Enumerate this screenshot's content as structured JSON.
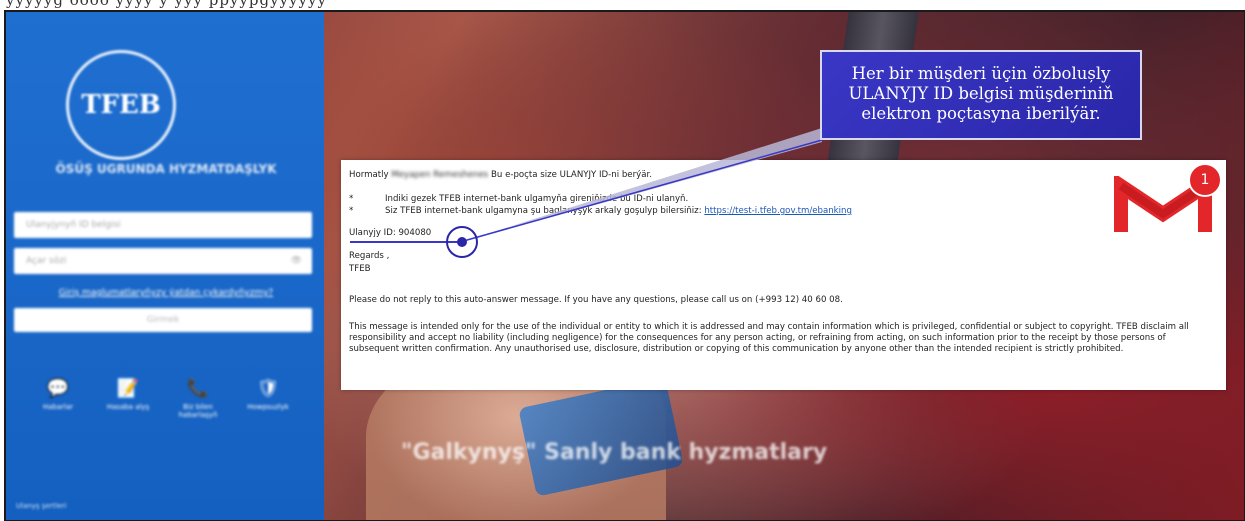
{
  "top_strip_text": "ÿyyyyg oooo yyyy y yyy ppyypgyyyyyy",
  "background": {
    "banner_text": "\"Galkynyş\" Sanly bank hyzmatlary"
  },
  "sidebar": {
    "logo_text": "TFEB",
    "tagline": "ÖSÜŞ UGRUNDA HYZMATDAŞLYK",
    "user_id_placeholder": "Ulanyjynyň ID belgisi",
    "password_placeholder": "Açar sözi",
    "forgot_link": "Giriş maglumatlaryňyzy ýatdan çykardyňyzmy?",
    "login_button": "Girmek",
    "icons": [
      {
        "label": "Habarlar",
        "glyph": "💬"
      },
      {
        "label": "Hasaba alyş",
        "glyph": "📝"
      },
      {
        "label": "Biz bilen habarlaşyň",
        "glyph": "📞"
      },
      {
        "label": "Howpsuzlyk",
        "glyph": "🛡"
      }
    ],
    "footer": "Ulanyş şertleri"
  },
  "callout": {
    "line1": "Her bir müşderi üçin özbolușly",
    "line2": "ULANYJY ID belgisi müşderiniň",
    "line3": "elektron poçtasyna iberilýär."
  },
  "email": {
    "greeting": "Hormatly",
    "recipient": "Meyapen Remeshenes",
    "intro": "Bu e-poçta size ULANYJY ID-ni berýär.",
    "bullet_mark": "*",
    "bullet1": "Indiki gezek TFEB internet-bank ulgamyňa gireniňizde bu ID-ni ulanyň.",
    "bullet2_text": "Siz TFEB internet-bank ulgamyna şu baglanyşyk arkaly goşulyp bilersiňiz:",
    "bullet2_link": "https://test-i.tfeb.gov.tm/ebanking",
    "id_line": "Ulanyjy ID: 904080",
    "regards": "Regards ,",
    "signature": "TFEB",
    "noreply": "Please do not reply to this auto-answer message. If you have any questions, please call us on (+993 12) 40 60 08.",
    "disclaimer": "This message is intended only for the use of the individual or entity to which it is addressed and may contain information which is privileged, confidential or subject to copyright. TFEB disclaim all responsibility and accept no liability (including negligence) for the consequences for any person acting, or refraining from acting, on such information prior to the receipt by those persons of subsequent written confirmation. Any unauthorised use, disclosure, distribution or copying of this communication by anyone other than the intended recipient is strictly prohibited."
  },
  "gmail": {
    "badge_count": "1"
  },
  "colors": {
    "sidebar_blue": "#1f6fd1",
    "callout_blue": "#2f2cb8",
    "gmail_red": "#e3262a"
  }
}
